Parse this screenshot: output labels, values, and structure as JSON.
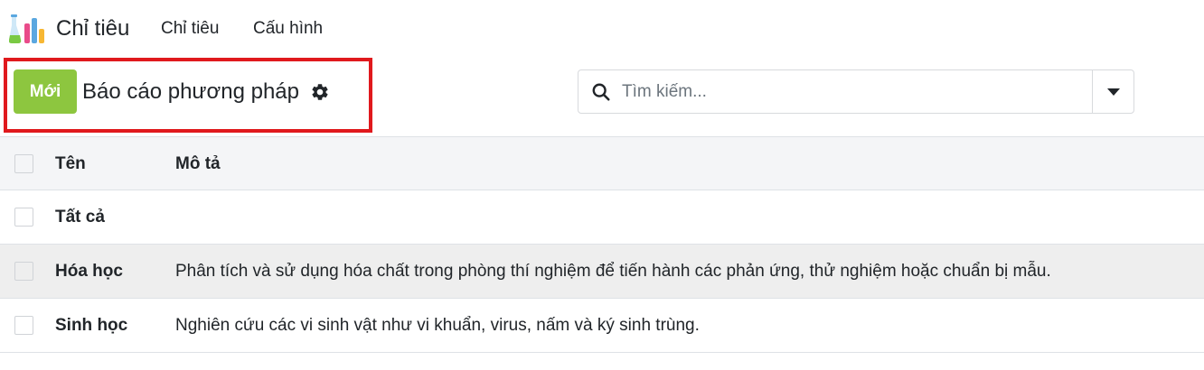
{
  "app": {
    "title": "Chỉ tiêu",
    "logo_icon": "flask-chart-icon"
  },
  "nav": {
    "items": [
      {
        "label": "Chỉ tiêu"
      },
      {
        "label": "Cấu hình"
      }
    ]
  },
  "control_panel": {
    "new_label": "Mới",
    "breadcrumb": "Báo cáo phương pháp",
    "gear_icon": "gear-icon",
    "accent_color": "#8dc63f",
    "highlight_color": "#e0191d"
  },
  "search": {
    "placeholder": "Tìm kiếm...",
    "value": ""
  },
  "table": {
    "columns": [
      "Tên",
      "Mô tả"
    ],
    "rows": [
      {
        "name": "Tất cả",
        "description": ""
      },
      {
        "name": "Hóa học",
        "description": "Phân tích và sử dụng hóa chất trong phòng thí nghiệm để tiến hành các phản ứng, thử nghiệm hoặc chuẩn bị mẫu."
      },
      {
        "name": "Sinh học",
        "description": "Nghiên cứu các vi sinh vật như vi khuẩn, virus, nấm và ký sinh trùng."
      }
    ]
  }
}
